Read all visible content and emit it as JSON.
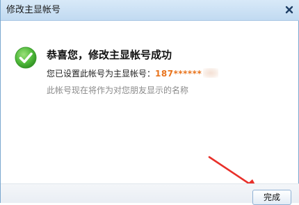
{
  "window": {
    "title": "修改主显帐号",
    "close_glyph": "×"
  },
  "message": {
    "headline": "恭喜您，修改主显帐号成功",
    "line2_prefix": "您已设置此帐号为主显帐号：",
    "account": "187******",
    "line3": "此帐号现在将作为对您朋友显示的名称"
  },
  "buttons": {
    "done_label": "完成"
  },
  "icons": {
    "success": "check-circle-icon",
    "close": "close-icon",
    "annotation": "red-arrow"
  },
  "colors": {
    "success_green": "#4fb93a",
    "account_orange": "#e8731c",
    "arrow_red": "#e8302a",
    "titlebar_blue": "#c9e0f5"
  }
}
